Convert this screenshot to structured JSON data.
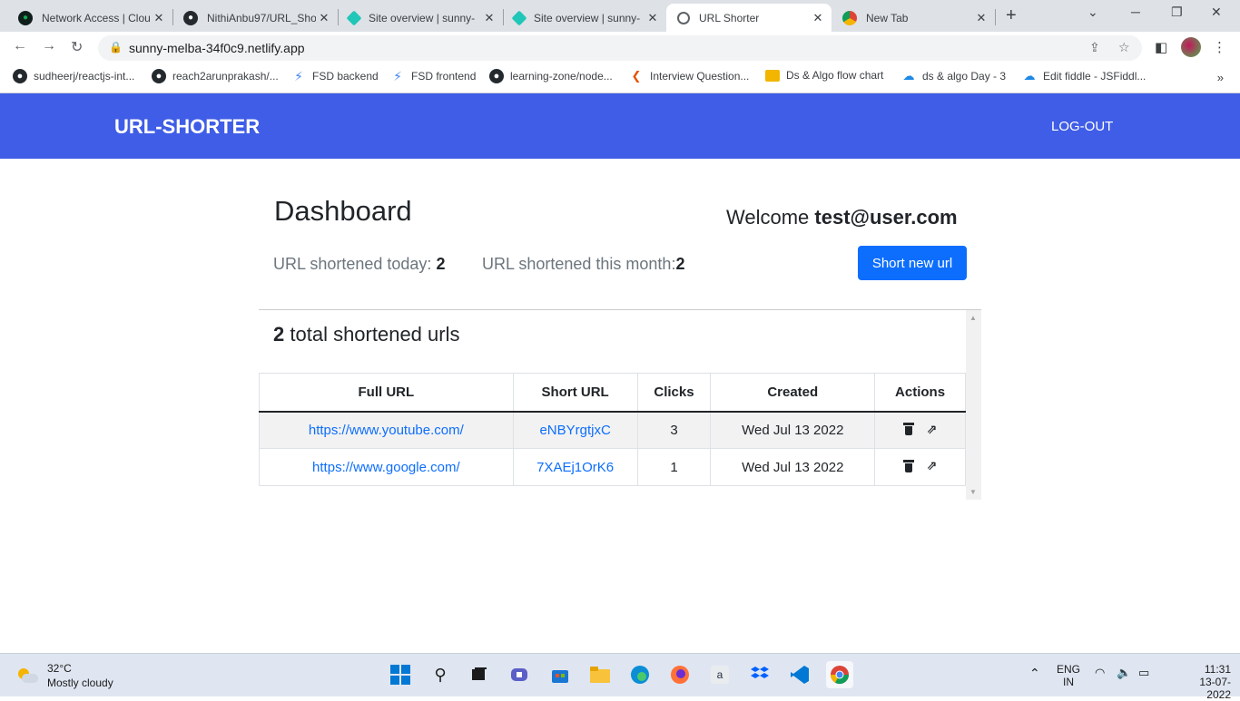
{
  "browser": {
    "tabs": [
      {
        "title": "Network Access | Clou",
        "icon": "mongodb-leaf-icon",
        "color": "#13aa52"
      },
      {
        "title": "NithiAnbu97/URL_Sho",
        "icon": "github-icon",
        "color": "#24292e"
      },
      {
        "title": "Site overview | sunny-",
        "icon": "netlify-icon",
        "color": "#20c6b7"
      },
      {
        "title": "Site overview | sunny-",
        "icon": "netlify-icon",
        "color": "#20c6b7"
      },
      {
        "title": "URL Shorter",
        "icon": "globe-icon",
        "color": "#5f6368"
      },
      {
        "title": "New Tab",
        "icon": "chrome-icon",
        "color": "#5f6368"
      }
    ],
    "url": "sunny-melba-34f0c9.netlify.app",
    "bookmarks": [
      {
        "label": "sudheerj/reactjs-int...",
        "icon": "github-icon"
      },
      {
        "label": "reach2arunprakash/...",
        "icon": "github-icon"
      },
      {
        "label": "FSD backend",
        "icon": "bolt-icon"
      },
      {
        "label": "FSD frontend",
        "icon": "bolt-icon"
      },
      {
        "label": "learning-zone/node...",
        "icon": "github-icon"
      },
      {
        "label": "Interview Question...",
        "icon": "interviewbit-icon"
      },
      {
        "label": "Ds & Algo flow chart",
        "icon": "folder-icon"
      },
      {
        "label": "ds & algo Day - 3",
        "icon": "cloud-icon"
      },
      {
        "label": "Edit fiddle - JSFiddl...",
        "icon": "cloud-icon"
      }
    ]
  },
  "navbar": {
    "brand": "URL-SHORTER",
    "logout": "LOG-OUT",
    "color": "#3f5de6"
  },
  "dashboard": {
    "title": "Dashboard",
    "welcome_prefix": "Welcome",
    "user": "test@user.com",
    "today_label": "URL shortened today: ",
    "today_value": "2",
    "month_label": "URL shortened this month:",
    "month_value": "2",
    "new_button": "Short new url",
    "total_count": "2",
    "total_label": "total shortened urls"
  },
  "table": {
    "headers": [
      "Full URL",
      "Short URL",
      "Clicks",
      "Created",
      "Actions"
    ],
    "rows": [
      {
        "full": "https://www.youtube.com/",
        "short": "eNBYrgtjxC",
        "clicks": "3",
        "created": "Wed Jul 13 2022"
      },
      {
        "full": "https://www.google.com/",
        "short": "7XAEj1OrK6",
        "clicks": "1",
        "created": "Wed Jul 13 2022"
      }
    ]
  },
  "taskbar": {
    "temp": "32°C",
    "weather": "Mostly cloudy",
    "lang1": "ENG",
    "lang2": "IN",
    "time": "11:31",
    "date": "13-07-2022"
  }
}
